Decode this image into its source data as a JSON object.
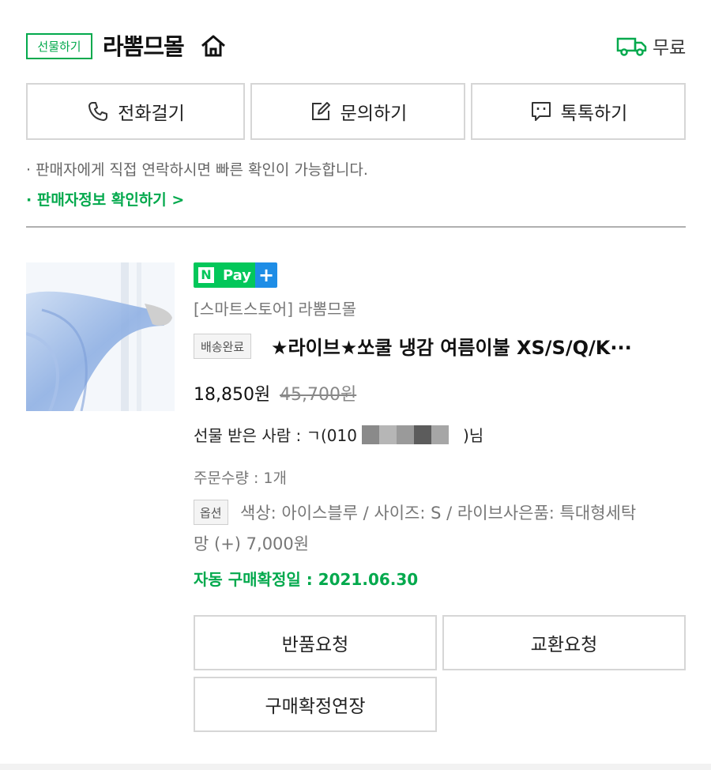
{
  "header": {
    "gift_badge": "선물하기",
    "store_name": "라뽐므몰",
    "shipping_label": "무료"
  },
  "contact": {
    "call_label": "전화걸기",
    "inquiry_label": "문의하기",
    "talk_label": "톡톡하기"
  },
  "notice": {
    "text": "· 판매자에게 직접 연락하시면 빠른 확인이 가능합니다.",
    "seller_info_link": "· 판매자정보 확인하기 >"
  },
  "order": {
    "npay_pay": "Pay",
    "npay_plus": "+",
    "npay_n": "N",
    "store_tag": "[스마트스토어] 라뽐므몰",
    "status_badge": "배송완료",
    "product_title": "★라이브★쏘쿨 냉감 여름이불 XS/S/Q/K···",
    "price": "18,850원",
    "original_price": "45,700원",
    "recipient_prefix": "선물 받은 사람 : ㄱ(010",
    "recipient_suffix": ")님",
    "quantity": "주문수량 : 1개",
    "option_badge": "옵션",
    "option_line1": "색상: 아이스블루 / 사이즈: S / 라이브사은품: 특대형세탁",
    "option_line2": "망 (+) 7,000원",
    "auto_confirm": "자동 구매확정일 : 2021.06.30"
  },
  "actions": {
    "return_label": "반품요청",
    "exchange_label": "교환요청",
    "extend_label": "구매확정연장"
  },
  "colors": {
    "naver_green": "#03a94d",
    "npay_blue": "#1e8de6",
    "border_gray": "#d6d6d6"
  }
}
